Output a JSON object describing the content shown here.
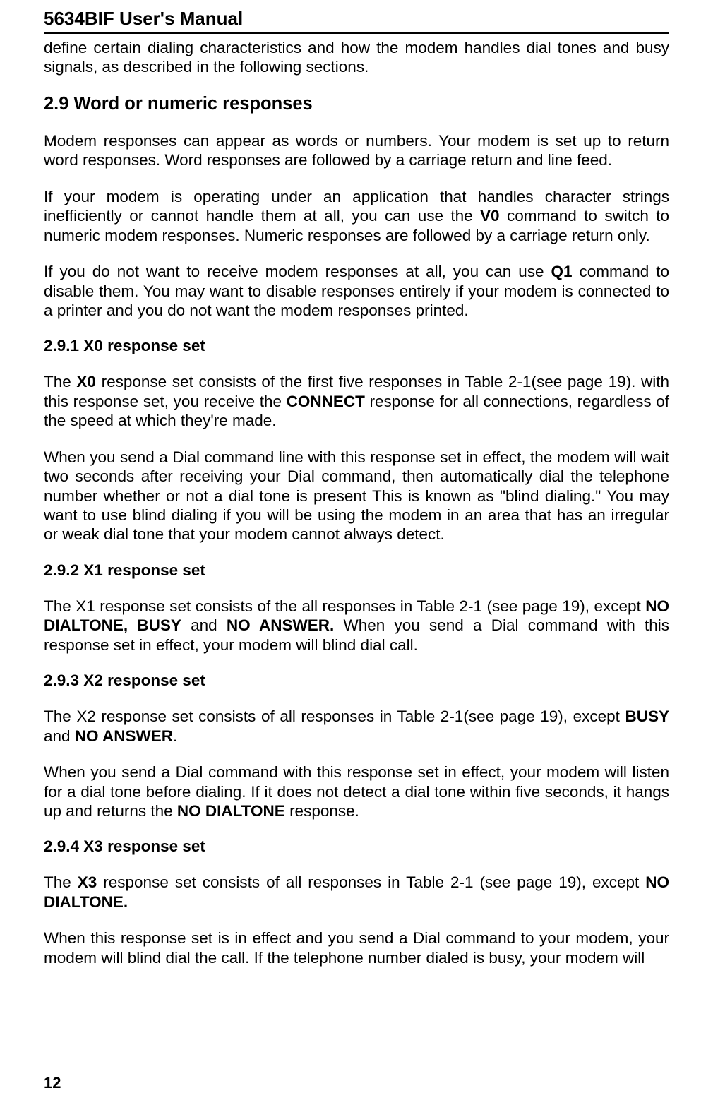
{
  "header": {
    "title": "5634BIF User's Manual"
  },
  "intro": {
    "line1_a": "define certain dialing characteristics and how the modem handles dial tones and busy signals, as described in the following sections."
  },
  "s29": {
    "heading": "2.9 Word or numeric responses",
    "p1": "Modem responses can appear as words or numbers. Your modem is set up to return word responses. Word responses are followed by a carriage return and line feed.",
    "p2_a": "If your modem is operating under an application that handles character strings inefficiently or cannot handle them at all, you can use the ",
    "p2_b": "V0",
    "p2_c": " command to switch to numeric modem responses. Numeric responses are followed by a carriage return only.",
    "p3_a": "If you do not want to receive modem responses at all, you can use ",
    "p3_b": "Q1",
    "p3_c": " command to disable them. You may want to disable responses entirely if your modem is connected to a printer and you do not want the modem responses printed."
  },
  "s291": {
    "heading": "2.9.1 X0 response set",
    "p1_a": "The ",
    "p1_b": "X0",
    "p1_c": " response set consists of the first five responses in Table 2-1(see page 19). with this response set, you receive the ",
    "p1_d": "CONNECT",
    "p1_e": " response for all connections, regardless of the speed at which they're made.",
    "p2": "When you send a Dial command line with this response set in effect, the modem will wait two seconds after receiving your Dial command, then automatically dial the telephone number whether or not a dial tone is present This is known as \"blind dialing.\" You may want to use blind dialing if you will be using the modem in an area that has an irregular or weak dial tone that your modem cannot always detect."
  },
  "s292": {
    "heading": "2.9.2 X1 response set",
    "p1_a": "The X1 response set consists of the all responses in Table 2-1 (see page 19), except ",
    "p1_b": "NO DIALTONE, BUSY",
    "p1_c": " and ",
    "p1_d": "NO ANSWER.",
    "p1_e": " When you send a Dial command with this response set in effect, your modem will blind dial call."
  },
  "s293": {
    "heading": "2.9.3 X2 response set",
    "p1_a": "The X2 response set consists of all responses in Table 2-1(see page 19), except ",
    "p1_b": "BUSY",
    "p1_c": " and ",
    "p1_d": "NO ANSWER",
    "p1_e": ".",
    "p2_a": "When you send a Dial command with this response set in effect, your modem will listen for a dial tone before dialing. If it does not detect a dial tone within five seconds, it hangs up and returns the ",
    "p2_b": "NO DIALTONE",
    "p2_c": " response."
  },
  "s294": {
    "heading": "2.9.4 X3 response set",
    "p1_a": "The ",
    "p1_b": "X3",
    "p1_c": " response set consists of all responses in Table 2-1 (see page 19), except ",
    "p1_d": "NO DIALTONE.",
    "p2": "When this response set is in effect and you send a Dial command to your modem, your modem will blind dial the call. If the telephone number dialed is busy, your modem will"
  },
  "page_number": "12"
}
